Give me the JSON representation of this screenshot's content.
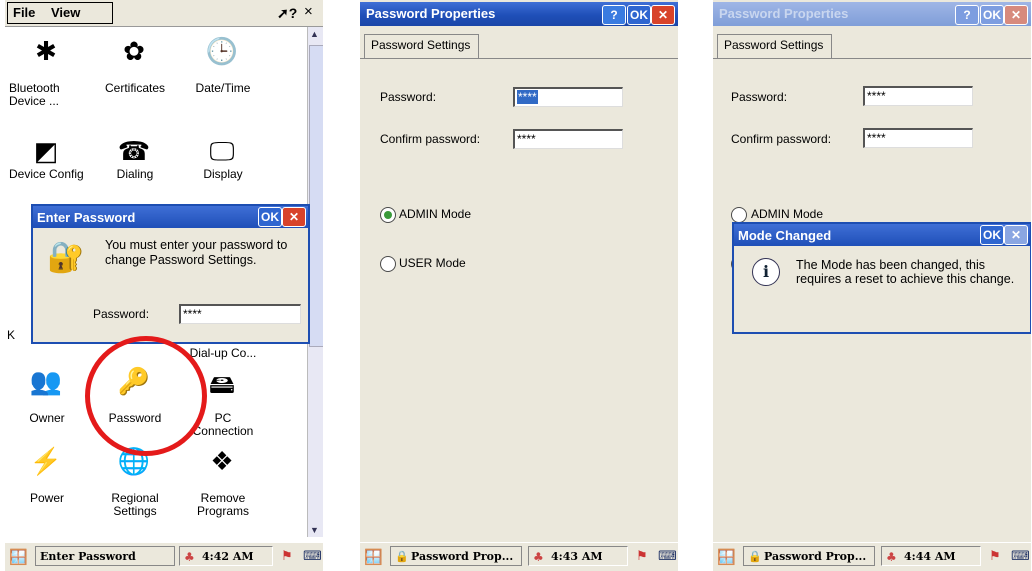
{
  "screen1": {
    "menu": {
      "file": "File",
      "view": "View",
      "help_icon": "help-pointer-icon",
      "close": "×"
    },
    "icons": [
      {
        "label": "Bluetooth Device ...",
        "icon": "bluetooth-icon",
        "glyph": "✱"
      },
      {
        "label": "Certificates",
        "icon": "certificates-icon",
        "glyph": "✿"
      },
      {
        "label": "Date/Time",
        "icon": "clock-icon",
        "glyph": "🕒"
      },
      {
        "label": "Device Config",
        "icon": "device-config-icon",
        "glyph": "◩"
      },
      {
        "label": "Dialing",
        "icon": "dialing-icon",
        "glyph": "☎"
      },
      {
        "label": "Display",
        "icon": "display-icon",
        "glyph": "🖵"
      },
      {
        "label": "Dial-up Co...",
        "icon": "dialup-icon",
        "glyph": ""
      },
      {
        "label": "Owner",
        "icon": "owner-icon",
        "glyph": "👥"
      },
      {
        "label": "Password",
        "icon": "password-icon",
        "glyph": "🔑"
      },
      {
        "label": "PC Connection",
        "icon": "pc-connection-icon",
        "glyph": "🖴"
      },
      {
        "label": "Power",
        "icon": "power-icon",
        "glyph": "⚡"
      },
      {
        "label": "Regional Settings",
        "icon": "regional-icon",
        "glyph": "🌐"
      },
      {
        "label": "Remove Programs",
        "icon": "remove-programs-icon",
        "glyph": "❖"
      }
    ],
    "partial_label": "K",
    "dialog": {
      "title": "Enter Password",
      "ok": "OK",
      "message": "You must enter your password to change Password Settings.",
      "password_label": "Password:",
      "password_value": "****"
    },
    "taskbar": {
      "task": "Enter Password",
      "time": "4:42 AM"
    }
  },
  "screen2": {
    "title": "Password Properties",
    "help": "?",
    "ok": "OK",
    "tab": "Password Settings",
    "password_label": "Password:",
    "password_value": "****",
    "confirm_label": "Confirm password:",
    "confirm_value": "****",
    "admin_mode": "ADMIN Mode",
    "user_mode": "USER Mode",
    "selected_mode": "ADMIN Mode",
    "taskbar": {
      "task": "Password Prop...",
      "time": "4:43 AM"
    }
  },
  "screen3": {
    "title": "Password Properties",
    "help": "?",
    "ok": "OK",
    "tab": "Password Settings",
    "password_label": "Password:",
    "password_value": "****",
    "confirm_label": "Confirm password:",
    "confirm_value": "****",
    "admin_mode": "ADMIN Mode",
    "dialog": {
      "title": "Mode Changed",
      "ok": "OK",
      "message": "The Mode has been changed, this requires a reset to achieve this change."
    },
    "taskbar": {
      "task": "Password Prop...",
      "time": "4:44 AM"
    }
  },
  "colors": {
    "titlebar": "#1f4fb8",
    "highlight_circle": "#e41a1a",
    "close": "#d8432a"
  }
}
